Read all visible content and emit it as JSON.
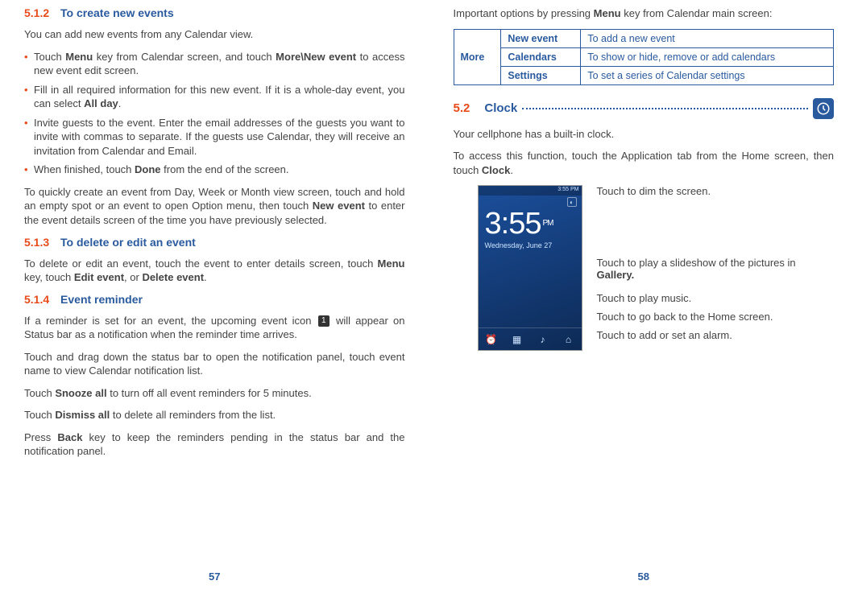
{
  "left": {
    "s512": {
      "num": "5.1.2",
      "title": "To create new events"
    },
    "intro": "You can add new events from any Calendar view.",
    "bullets": {
      "b1a": "Touch ",
      "b1b": "Menu",
      "b1c": " key from Calendar screen, and touch ",
      "b1d": "More\\New event",
      "b1e": " to access new event edit screen.",
      "b2a": "Fill in all required information for this new event. If it is a whole-day event, you can select ",
      "b2b": "All day",
      "b2c": ".",
      "b3": "Invite guests to the event. Enter the email addresses of the guests you want to invite with commas to separate. If the guests use Calendar, they will receive an invitation from Calendar and Email.",
      "b4a": "When finished, touch ",
      "b4b": "Done",
      "b4c": " from the end of the screen."
    },
    "quick": {
      "a": "To quickly create an event from Day, Week or Month view screen, touch and hold an empty spot or an event to open Option menu, then touch ",
      "b": "New event",
      "c": " to enter the event details screen of the time you have previously selected."
    },
    "s513": {
      "num": "5.1.3",
      "title": "To delete or edit an event"
    },
    "editdel": {
      "a": "To delete or edit an event, touch the event to enter details screen, touch ",
      "b": "Menu",
      "c": " key, touch ",
      "d": "Edit event",
      "e": ", or ",
      "f": "Delete event",
      "g": "."
    },
    "s514": {
      "num": "5.1.4",
      "title": "Event reminder"
    },
    "rem1a": "If a reminder is set for an event, the upcoming event icon ",
    "rem1b": " will appear on Status bar as a notification when the reminder time arrives.",
    "rem2": "Touch and drag down the status bar to open the notification panel, touch event name to view Calendar notification list.",
    "rem3a": "Touch ",
    "rem3b": "Snooze all",
    "rem3c": " to turn off all event reminders for 5 minutes.",
    "rem4a": "Touch ",
    "rem4b": "Dismiss all",
    "rem4c": " to delete all reminders from the list.",
    "rem5a": "Press ",
    "rem5b": "Back",
    "rem5c": " key to keep the reminders pending in the status bar and the notification panel.",
    "pagenum": "57",
    "event_icon_glyph": "1"
  },
  "right": {
    "topline_a": "Important options by pressing ",
    "topline_b": "Menu",
    "topline_c": " key from Calendar main screen:",
    "table": {
      "more": "More",
      "r1a": "New event",
      "r1b": "To add a new event",
      "r2a": "Calendars",
      "r2b": "To show or hide, remove or add calendars",
      "r3a": "Settings",
      "r3b": "To set a series of Calendar settings"
    },
    "s52": {
      "num": "5.2",
      "title": "Clock"
    },
    "clock_intro": "Your cellphone has a built-in clock.",
    "clock_access_a": "To access this function, touch the Application tab from the Home screen, then touch ",
    "clock_access_b": "Clock",
    "clock_access_c": ".",
    "phone": {
      "status": "3:55 PM",
      "time": "3:55",
      "ampm": "PM",
      "date": "Wednesday, June 27"
    },
    "callouts": {
      "c1": "Touch to dim the screen.",
      "c2a": "Touch to play a slideshow of the pictures in ",
      "c2b": "Gallery.",
      "c3": "Touch to play music.",
      "c4": "Touch to go back to the Home screen.",
      "c5": "Touch to add or set an alarm."
    },
    "pagenum": "58"
  }
}
